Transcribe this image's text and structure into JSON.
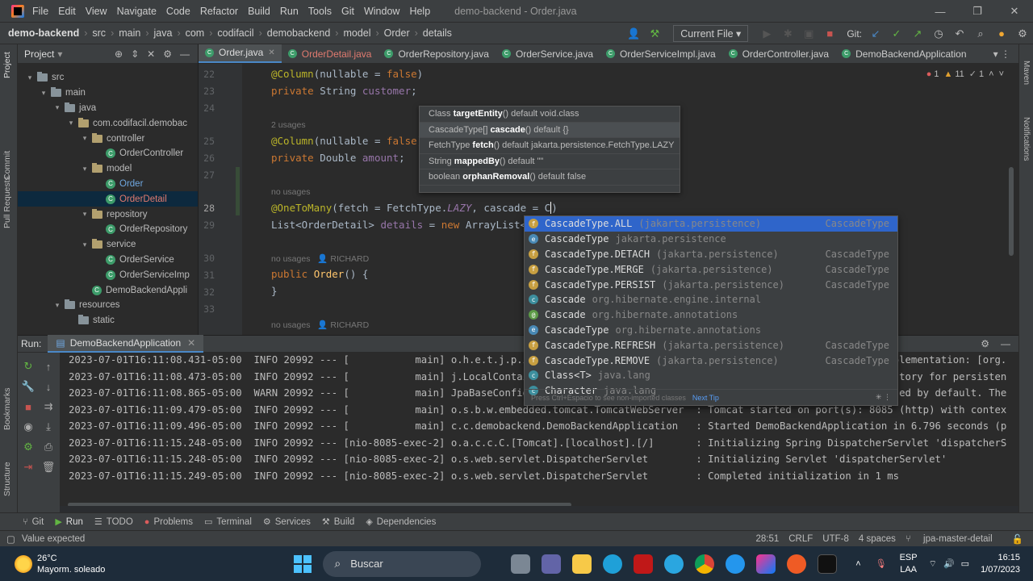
{
  "window": {
    "title": "demo-backend - Order.java",
    "menu": [
      "File",
      "Edit",
      "View",
      "Navigate",
      "Code",
      "Refactor",
      "Build",
      "Run",
      "Tools",
      "Git",
      "Window",
      "Help"
    ]
  },
  "breadcrumb": [
    "demo-backend",
    "src",
    "main",
    "java",
    "com",
    "codifacil",
    "demobackend",
    "model",
    "Order",
    "details"
  ],
  "toolbar": {
    "run_config": "Current File",
    "git_label": "Git:"
  },
  "project_panel": {
    "title": "Project",
    "tree": [
      {
        "label": "src",
        "depth": 1,
        "kind": "folder",
        "arrow": "▾"
      },
      {
        "label": "main",
        "depth": 2,
        "kind": "folder",
        "arrow": "▾"
      },
      {
        "label": "java",
        "depth": 3,
        "kind": "folder",
        "arrow": "▾"
      },
      {
        "label": "com.codifacil.demobac",
        "depth": 4,
        "kind": "pkg",
        "arrow": "▾"
      },
      {
        "label": "controller",
        "depth": 5,
        "kind": "pkg",
        "arrow": "▾"
      },
      {
        "label": "OrderController",
        "depth": 6,
        "kind": "class"
      },
      {
        "label": "model",
        "depth": 5,
        "kind": "pkg",
        "arrow": "▾"
      },
      {
        "label": "Order",
        "depth": 6,
        "kind": "class",
        "color": "blue"
      },
      {
        "label": "OrderDetail",
        "depth": 6,
        "kind": "class",
        "color": "red",
        "selected": true
      },
      {
        "label": "repository",
        "depth": 5,
        "kind": "pkg",
        "arrow": "▾"
      },
      {
        "label": "OrderRepository",
        "depth": 6,
        "kind": "class"
      },
      {
        "label": "service",
        "depth": 5,
        "kind": "pkg",
        "arrow": "▾"
      },
      {
        "label": "OrderService",
        "depth": 6,
        "kind": "class"
      },
      {
        "label": "OrderServiceImp",
        "depth": 6,
        "kind": "class"
      },
      {
        "label": "DemoBackendAppli",
        "depth": 5,
        "kind": "class"
      },
      {
        "label": "resources",
        "depth": 3,
        "kind": "folder",
        "arrow": "▾"
      },
      {
        "label": "static",
        "depth": 4,
        "kind": "folder"
      }
    ]
  },
  "tabs": [
    {
      "label": "Order.java",
      "active": true
    },
    {
      "label": "OrderDetail.java",
      "color": "red"
    },
    {
      "label": "OrderRepository.java"
    },
    {
      "label": "OrderService.java"
    },
    {
      "label": "OrderServiceImpl.java"
    },
    {
      "label": "OrderController.java"
    },
    {
      "label": "DemoBackendApplication"
    }
  ],
  "inspections": {
    "errors": "1",
    "warnings": "11",
    "weak": "1"
  },
  "editor": {
    "line_numbers": [
      "22",
      "23",
      "24",
      "25",
      "26",
      "27",
      "28",
      "29",
      "30",
      "31",
      "32",
      "33"
    ],
    "hint_2usages": "2 usages",
    "hint_nousages": "no usages",
    "hint_nousages_richard": "no usages",
    "author": "RICHARD"
  },
  "param_hint": [
    {
      "pre": "Class ",
      "bold": "targetEntity",
      "post": "() default void.class"
    },
    {
      "pre": "CascadeType[] ",
      "bold": "cascade",
      "post": "() default {}"
    },
    {
      "pre": "FetchType ",
      "bold": "fetch",
      "post": "() default jakarta.persistence.FetchType.LAZY"
    },
    {
      "pre": "String ",
      "bold": "mappedBy",
      "post": "() default \"\""
    },
    {
      "pre": "boolean ",
      "bold": "orphanRemoval",
      "post": "() default false"
    }
  ],
  "completion": {
    "items": [
      {
        "icon": "f",
        "name": "CascadeType.ALL",
        "pkg": "(jakarta.persistence)",
        "type": "CascadeType",
        "selected": true
      },
      {
        "icon": "e",
        "name": "CascadeType",
        "pkg": "jakarta.persistence",
        "type": ""
      },
      {
        "icon": "f",
        "name": "CascadeType.DETACH",
        "pkg": "(jakarta.persistence)",
        "type": "CascadeType"
      },
      {
        "icon": "f",
        "name": "CascadeType.MERGE",
        "pkg": "(jakarta.persistence)",
        "type": "CascadeType"
      },
      {
        "icon": "f",
        "name": "CascadeType.PERSIST",
        "pkg": "(jakarta.persistence)",
        "type": "CascadeType"
      },
      {
        "icon": "c",
        "name": "Cascade",
        "pkg": "org.hibernate.engine.internal",
        "type": ""
      },
      {
        "icon": "a",
        "name": "Cascade",
        "pkg": "org.hibernate.annotations",
        "type": ""
      },
      {
        "icon": "e",
        "name": "CascadeType",
        "pkg": "org.hibernate.annotations",
        "type": ""
      },
      {
        "icon": "f",
        "name": "CascadeType.REFRESH",
        "pkg": "(jakarta.persistence)",
        "type": "CascadeType"
      },
      {
        "icon": "f",
        "name": "CascadeType.REMOVE",
        "pkg": "(jakarta.persistence)",
        "type": "CascadeType"
      },
      {
        "icon": "c",
        "name": "Class<T>",
        "pkg": "java.lang",
        "type": ""
      },
      {
        "icon": "c",
        "name": "Character",
        "pkg": "java.lang",
        "type": ""
      }
    ],
    "footer": "Press Ctrl+Espacio to see non-imported classes",
    "next_tip": "Next Tip"
  },
  "run_panel": {
    "label": "Run:",
    "tab": "DemoBackendApplication",
    "log": [
      "2023-07-01T16:11:08.431-05:00  INFO 20992 --- [           main] o.h.e.t.j.p.i.JtaPlatformInitiator       : HHH000490: Using JtaPlatform implementation: [org.",
      "2023-07-01T16:11:08.473-05:00  INFO 20992 --- [           main] j.LocalContainerEntityManagerFactoryBean : Initialized JPA EntityManagerFactory for persisten",
      "2023-07-01T16:11:08.865-05:00  WARN 20992 --- [           main] JpaBaseConfiguration$JpaWebConfiguration : spring.jpa.open-in-view is enabled by default. The",
      "2023-07-01T16:11:09.479-05:00  INFO 20992 --- [           main] o.s.b.w.embedded.tomcat.TomcatWebServer  : Tomcat started on port(s): 8085 (http) with contex",
      "2023-07-01T16:11:09.496-05:00  INFO 20992 --- [           main] c.c.demobackend.DemoBackendApplication   : Started DemoBackendApplication in 6.796 seconds (p",
      "2023-07-01T16:11:15.248-05:00  INFO 20992 --- [nio-8085-exec-2] o.a.c.c.C.[Tomcat].[localhost].[/]       : Initializing Spring DispatcherServlet 'dispatcherS",
      "2023-07-01T16:11:15.248-05:00  INFO 20992 --- [nio-8085-exec-2] o.s.web.servlet.DispatcherServlet        : Initializing Servlet 'dispatcherServlet'",
      "2023-07-01T16:11:15.249-05:00  INFO 20992 --- [nio-8085-exec-2] o.s.web.servlet.DispatcherServlet        : Completed initialization in 1 ms"
    ]
  },
  "bottom_tabs": [
    "Git",
    "Run",
    "TODO",
    "Problems",
    "Terminal",
    "Services",
    "Build",
    "Dependencies"
  ],
  "status": {
    "message": "Value expected",
    "position": "28:51",
    "line_sep": "CRLF",
    "encoding": "UTF-8",
    "indent": "4 spaces",
    "branch": "jpa-master-detail"
  },
  "side_tools": {
    "left": [
      "Project",
      "Commit",
      "Pull Requests",
      "Bookmarks",
      "Structure"
    ],
    "right": [
      "Maven",
      "Notifications"
    ]
  },
  "taskbar": {
    "temp": "26°C",
    "weather": "Mayorm. soleado",
    "search": "Buscar",
    "lang": "ESP",
    "lang2": "LAA",
    "time": "16:15",
    "date": "1/07/2023"
  }
}
